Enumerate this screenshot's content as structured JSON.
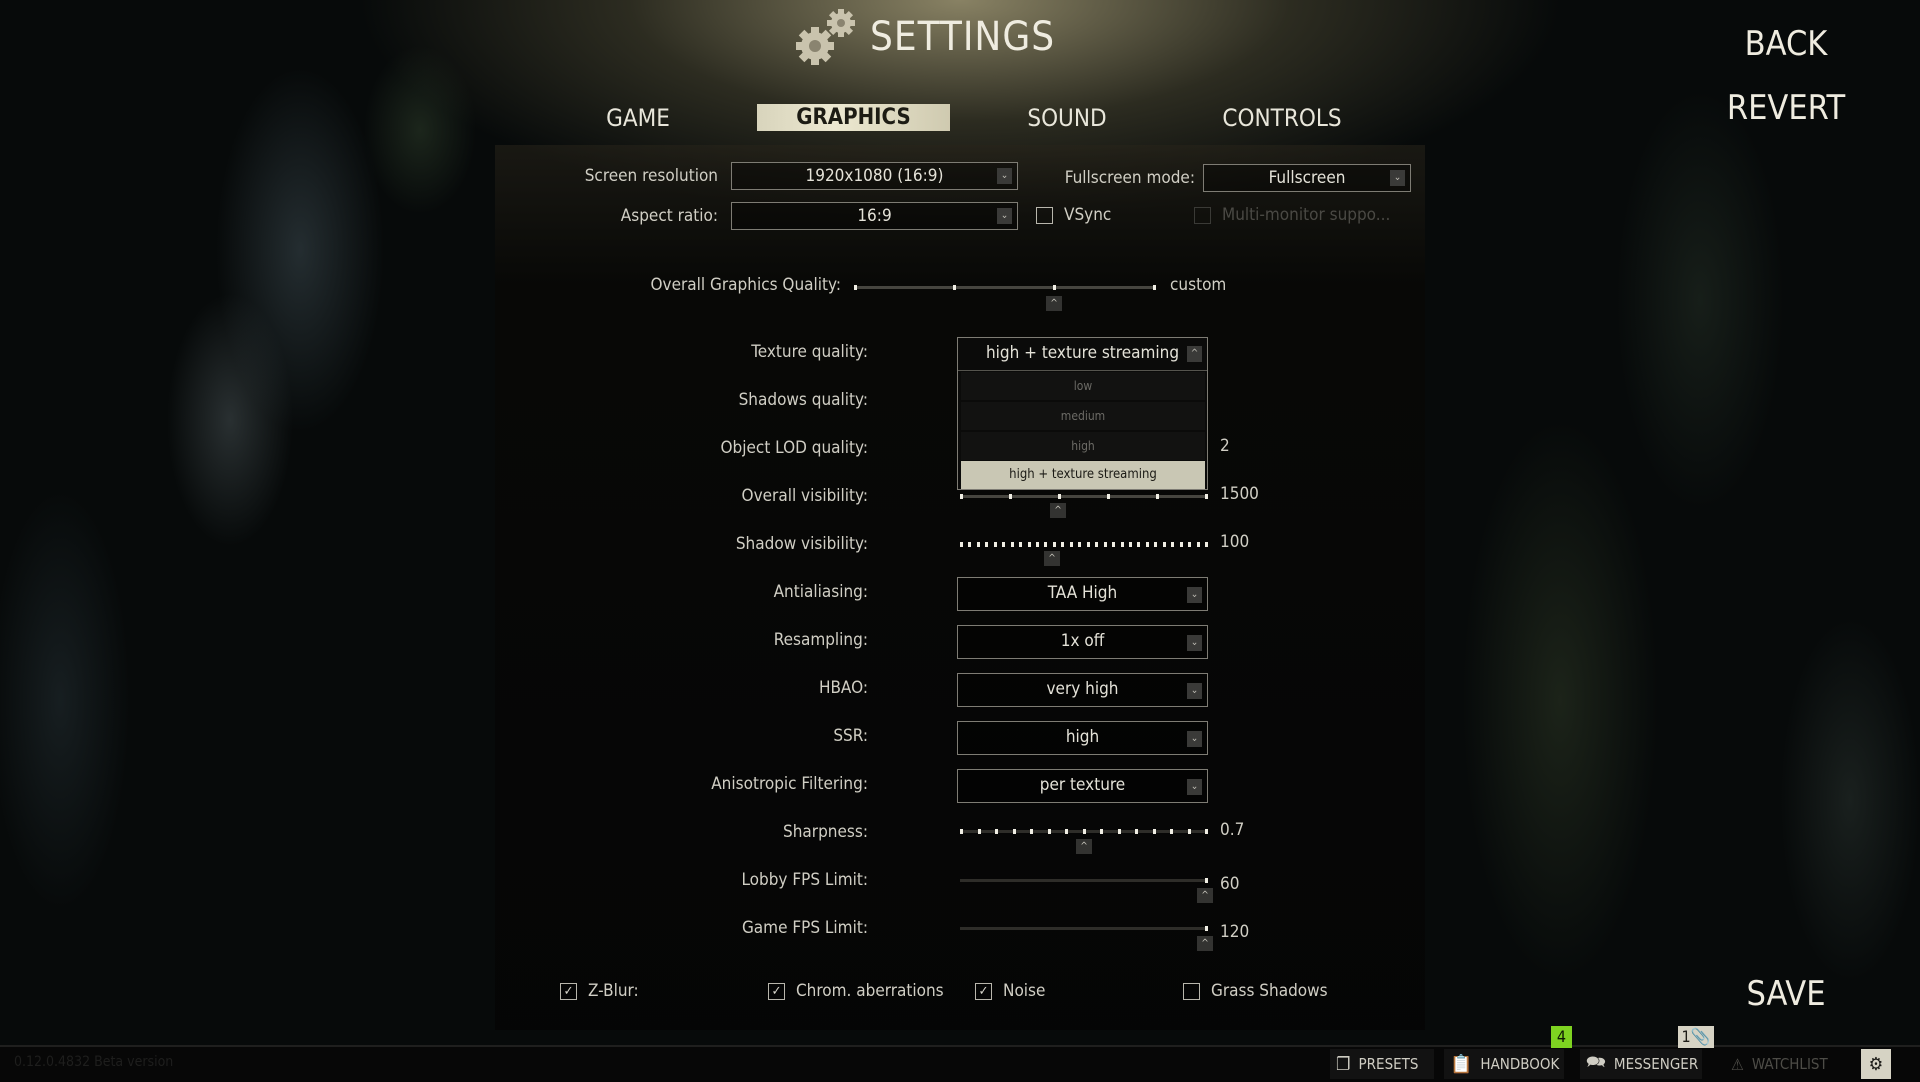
{
  "header": {
    "title": "SETTINGS",
    "icon": "gears-icon"
  },
  "tabs": [
    {
      "label": "GAME",
      "active": false
    },
    {
      "label": "GRAPHICS",
      "active": true
    },
    {
      "label": "SOUND",
      "active": false
    },
    {
      "label": "CONTROLS",
      "active": false
    }
  ],
  "side_buttons": {
    "back": "BACK",
    "revert": "REVERT",
    "save": "SAVE"
  },
  "display": {
    "screen_resolution": {
      "label": "Screen resolution",
      "value": "1920x1080 (16:9)"
    },
    "aspect_ratio": {
      "label": "Aspect ratio:",
      "value": "16:9"
    },
    "fullscreen_mode": {
      "label": "Fullscreen mode:",
      "value": "Fullscreen"
    },
    "vsync": {
      "label": "VSync",
      "checked": false
    },
    "multi_monitor": {
      "label": "Multi-monitor suppo...",
      "checked": false,
      "disabled": true
    }
  },
  "overall_quality": {
    "label": "Overall Graphics Quality:",
    "value": "custom",
    "position_fraction": 0.67
  },
  "settings": {
    "texture_quality": {
      "label": "Texture quality:",
      "value": "high + texture streaming",
      "open": true,
      "options": [
        "low",
        "medium",
        "high",
        "high + texture streaming"
      ]
    },
    "shadows_quality": {
      "label": "Shadows quality:"
    },
    "object_lod": {
      "label": "Object LOD quality:",
      "value": "2"
    },
    "overall_visibility": {
      "label": "Overall visibility:",
      "value": "1500",
      "position_fraction": 0.4
    },
    "shadow_visibility": {
      "label": "Shadow visibility:",
      "value": "100",
      "position_fraction": 0.37
    },
    "antialiasing": {
      "label": "Antialiasing:",
      "value": "TAA High"
    },
    "resampling": {
      "label": "Resampling:",
      "value": "1x off"
    },
    "hbao": {
      "label": "HBAO:",
      "value": "very high"
    },
    "ssr": {
      "label": "SSR:",
      "value": "high"
    },
    "anisotropic": {
      "label": "Anisotropic Filtering:",
      "value": "per texture"
    },
    "sharpness": {
      "label": "Sharpness:",
      "value": "0.7",
      "position_fraction": 0.5
    },
    "lobby_fps": {
      "label": "Lobby FPS Limit:",
      "value": "60",
      "position_fraction": 1.0
    },
    "game_fps": {
      "label": "Game FPS Limit:",
      "value": "120",
      "position_fraction": 1.0
    }
  },
  "toggles": [
    {
      "label": "Z-Blur:",
      "checked": true
    },
    {
      "label": "Chrom. aberrations",
      "checked": true
    },
    {
      "label": "Noise",
      "checked": true
    },
    {
      "label": "Grass Shadows",
      "checked": false
    }
  ],
  "bottom_bar": {
    "version": "0.12.0.4832 Beta version",
    "items": [
      {
        "label": "PRESETS",
        "icon": "presets-icon"
      },
      {
        "label": "HANDBOOK",
        "icon": "handbook-icon"
      },
      {
        "label": "MESSENGER",
        "icon": "messenger-icon"
      },
      {
        "label": "WATCHLIST",
        "icon": "warning-icon"
      }
    ],
    "handbook_badge": "4",
    "messenger_badge": "1",
    "settings_icon": "gears-icon"
  },
  "colors": {
    "accent_tab": "#e8e4cc",
    "badge_green": "#7ed321",
    "badge_cream": "#d6d3c4",
    "selected_option": "#c9c7b4"
  }
}
